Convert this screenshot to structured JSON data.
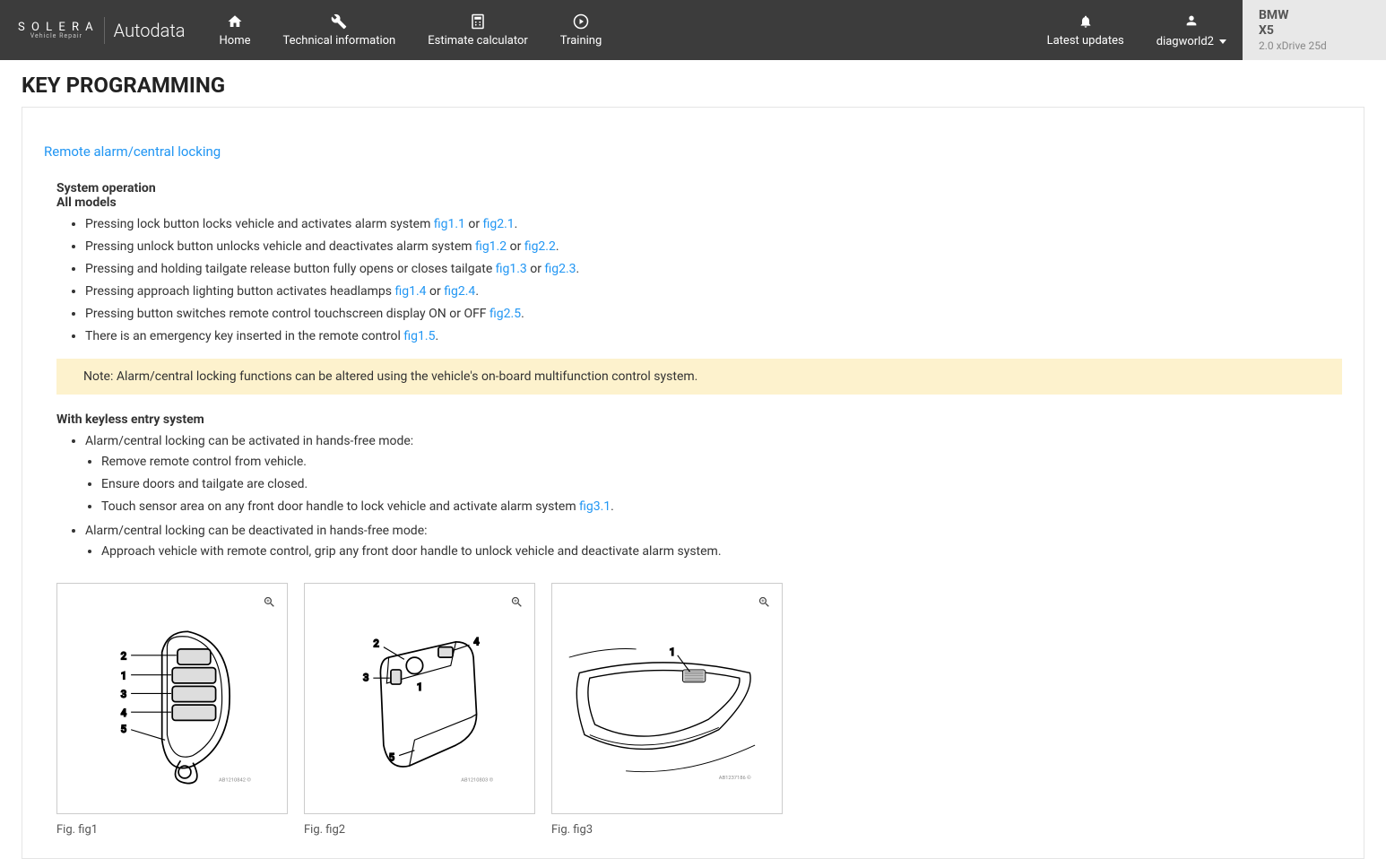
{
  "header": {
    "logo_primary": "S O L E R A",
    "logo_primary_sub": "Vehicle Repair",
    "logo_secondary": "Autodata",
    "nav": {
      "home": "Home",
      "tech": "Technical information",
      "estimate": "Estimate calculator",
      "training": "Training",
      "updates": "Latest updates",
      "user": "diagworld2"
    },
    "vehicle": {
      "make": "BMW",
      "model": "X5",
      "variant": "2.0 xDrive 25d"
    }
  },
  "page": {
    "title": "KEY PROGRAMMING",
    "section_link": "Remote alarm/central locking",
    "system_operation": "System operation",
    "all_models": "All models",
    "bullets": [
      {
        "pre": "Pressing lock button locks vehicle and activates alarm system ",
        "links": [
          {
            "t": "fig1.1"
          },
          {
            "sep": " or "
          },
          {
            "t": "fig2.1"
          }
        ],
        "post": "."
      },
      {
        "pre": "Pressing unlock button unlocks vehicle and deactivates alarm system ",
        "links": [
          {
            "t": "fig1.2"
          },
          {
            "sep": " or "
          },
          {
            "t": "fig2.2"
          }
        ],
        "post": "."
      },
      {
        "pre": "Pressing and holding tailgate release button fully opens or closes tailgate ",
        "links": [
          {
            "t": "fig1.3"
          },
          {
            "sep": " or "
          },
          {
            "t": "fig2.3"
          }
        ],
        "post": "."
      },
      {
        "pre": "Pressing approach lighting button activates headlamps ",
        "links": [
          {
            "t": "fig1.4"
          },
          {
            "sep": " or "
          },
          {
            "t": "fig2.4"
          }
        ],
        "post": "."
      },
      {
        "pre": "Pressing button switches remote control touchscreen display ON or OFF ",
        "links": [
          {
            "t": "fig2.5"
          }
        ],
        "post": "."
      },
      {
        "pre": "There is an emergency key inserted in the remote control ",
        "links": [
          {
            "t": "fig1.5"
          }
        ],
        "post": "."
      }
    ],
    "note": "Note: Alarm/central locking functions can be altered using the vehicle's on-board multifunction control system.",
    "keyless_heading": "With keyless entry system",
    "keyless": {
      "activate_intro": "Alarm/central locking can be activated in hands-free mode:",
      "activate_steps": [
        "Remove remote control from vehicle.",
        "Ensure doors and tailgate are closed."
      ],
      "touch_pre": "Touch sensor area on any front door handle to lock vehicle and activate alarm system ",
      "touch_link": "fig3.1",
      "touch_post": ".",
      "deactivate_intro": "Alarm/central locking can be deactivated in hands-free mode:",
      "deactivate_step": "Approach vehicle with remote control, grip any front door handle to unlock vehicle and deactivate alarm system."
    },
    "figures": [
      {
        "caption": "Fig. fig1"
      },
      {
        "caption": "Fig. fig2"
      },
      {
        "caption": "Fig. fig3"
      }
    ]
  }
}
